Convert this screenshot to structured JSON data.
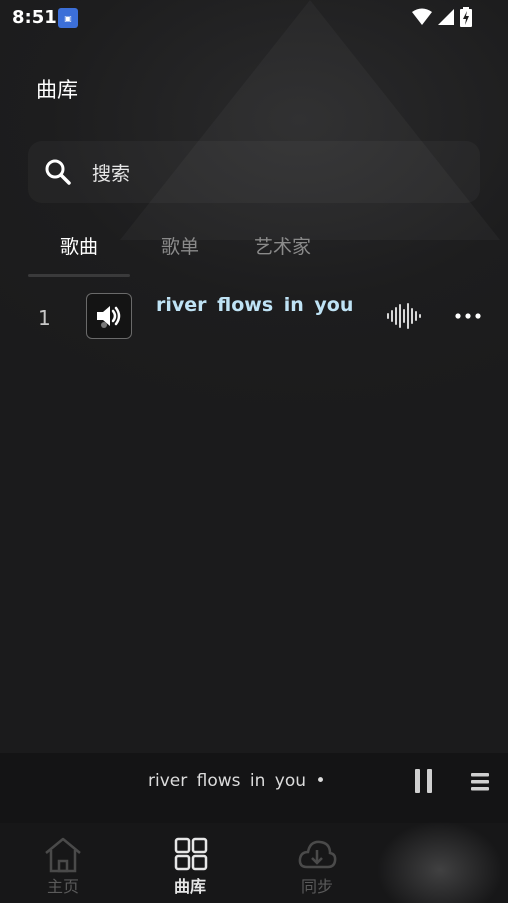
{
  "status_bar": {
    "time": "8:51",
    "app_icon": "app-notification-icon",
    "icons": [
      "wifi-icon",
      "cell-signal-icon",
      "battery-charging-icon"
    ]
  },
  "header": {
    "title": "曲库"
  },
  "search": {
    "placeholder": "搜索",
    "icon": "search-icon"
  },
  "tabs": [
    {
      "label": "歌曲",
      "active": true
    },
    {
      "label": "歌单",
      "active": false
    },
    {
      "label": "艺术家",
      "active": false
    }
  ],
  "songs": [
    {
      "index": "1",
      "title": "river  flows  in  you",
      "cover_icon": "speaker-icon",
      "status_icon": "waveform-icon",
      "menu_icon": "more-icon"
    }
  ],
  "player": {
    "title": "river  flows  in  you •",
    "pause_icon": "pause-icon",
    "queue_icon": "queue-icon"
  },
  "bottom_nav": [
    {
      "label": "主页",
      "icon": "home-icon",
      "active": false
    },
    {
      "label": "曲库",
      "icon": "library-grid-icon",
      "active": true
    },
    {
      "label": "同步",
      "icon": "cloud-download-icon",
      "active": false
    }
  ],
  "colors": {
    "background": "#1c1c1d",
    "song_title": "#bfe3f5",
    "inactive_text": "#8a8a8a"
  }
}
